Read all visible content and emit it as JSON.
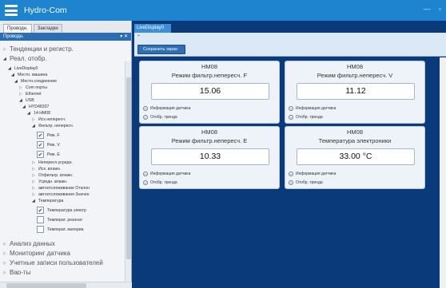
{
  "app": {
    "title": "Hydro-Com"
  },
  "left_panel": {
    "tabs": [
      "Проводн.",
      "Закладки"
    ],
    "header": "Проводн.",
    "header_controls": "▾ ✕",
    "tree": [
      {
        "label": "Тенденции и регистр.",
        "level": 0,
        "expanded": false
      },
      {
        "label": "Реал. отобр.",
        "level": 0,
        "expanded": true
      },
      {
        "label": "LiveDisplay0",
        "level": 1,
        "expanded": true
      },
      {
        "label": "Местн. машина",
        "level": 1,
        "expanded": true
      },
      {
        "label": "Местн.соединение",
        "level": 1,
        "expanded": true
      },
      {
        "label": "Com порты",
        "level": 1,
        "expanded": false
      },
      {
        "label": "Ethernet",
        "level": 1,
        "expanded": false
      },
      {
        "label": "USB",
        "level": 1,
        "expanded": true
      },
      {
        "label": "HYD48337",
        "level": 1,
        "expanded": true
      },
      {
        "label": "14:HM08",
        "level": 1,
        "expanded": true
      },
      {
        "label": "Исх.непересч.",
        "level": 1,
        "expanded": false
      },
      {
        "label": "Фильтр. непересч.",
        "level": 1,
        "expanded": true
      },
      {
        "label": "Реж. F",
        "level": 2,
        "checked": true
      },
      {
        "label": "Реж. V",
        "level": 2,
        "checked": true
      },
      {
        "label": "Реж. E",
        "level": 2,
        "checked": true
      },
      {
        "label": "Непересч.усредн.",
        "level": 1,
        "expanded": false
      },
      {
        "label": "Исх. влажн.",
        "level": 1,
        "expanded": false
      },
      {
        "label": "Отфильтр. влажн.",
        "level": 1,
        "expanded": false
      },
      {
        "label": "Усредн. влажн.",
        "level": 1,
        "expanded": false
      },
      {
        "label": "автоотслеживание Отклон",
        "level": 1,
        "expanded": false
      },
      {
        "label": "автоотслеживания Значен",
        "level": 1,
        "expanded": false
      },
      {
        "label": "Температура",
        "level": 1,
        "expanded": true
      },
      {
        "label": "Температура электр",
        "level": 2,
        "checked": true
      },
      {
        "label": "Температ. резонат",
        "level": 2,
        "checked": false
      },
      {
        "label": "Температ. материа",
        "level": 2,
        "checked": false
      },
      {
        "label": "Анализ данных",
        "level": 0,
        "expanded": false
      },
      {
        "label": "Мониторинг датчика",
        "level": 0,
        "expanded": false
      },
      {
        "label": "Учетные записи пользователей",
        "level": 0,
        "expanded": false
      },
      {
        "label": "Вар-ты",
        "level": 0,
        "expanded": false
      }
    ]
  },
  "main": {
    "doc_tab": "LiveDisplay0",
    "collapse_glyph": "⌃",
    "save_button": "Сохранить экран",
    "cards": [
      {
        "device": "HM08",
        "param": "Режим фильтр.непересч. F",
        "value": "15.06",
        "info": "Информация датчика",
        "trend": "Отобр. тренда"
      },
      {
        "device": "HM08",
        "param": "Режим фильтр.непересч. V",
        "value": "11.12",
        "info": "Информация датчика",
        "trend": "Отобр. тренда"
      },
      {
        "device": "HM08",
        "param": "Режим фильтр.непересч. E",
        "value": "10.33",
        "info": "Информация датчика",
        "trend": "Отобр. тренда"
      },
      {
        "device": "HM08",
        "param": "Температура электроники",
        "value": "33.00 °C",
        "info": "Информация датчика",
        "trend": "Отобр. тренда"
      }
    ]
  },
  "colors": {
    "titlebar": "#1e84d0",
    "workspace": "#0a3a7a",
    "accent_button": "#2f6fb4"
  }
}
